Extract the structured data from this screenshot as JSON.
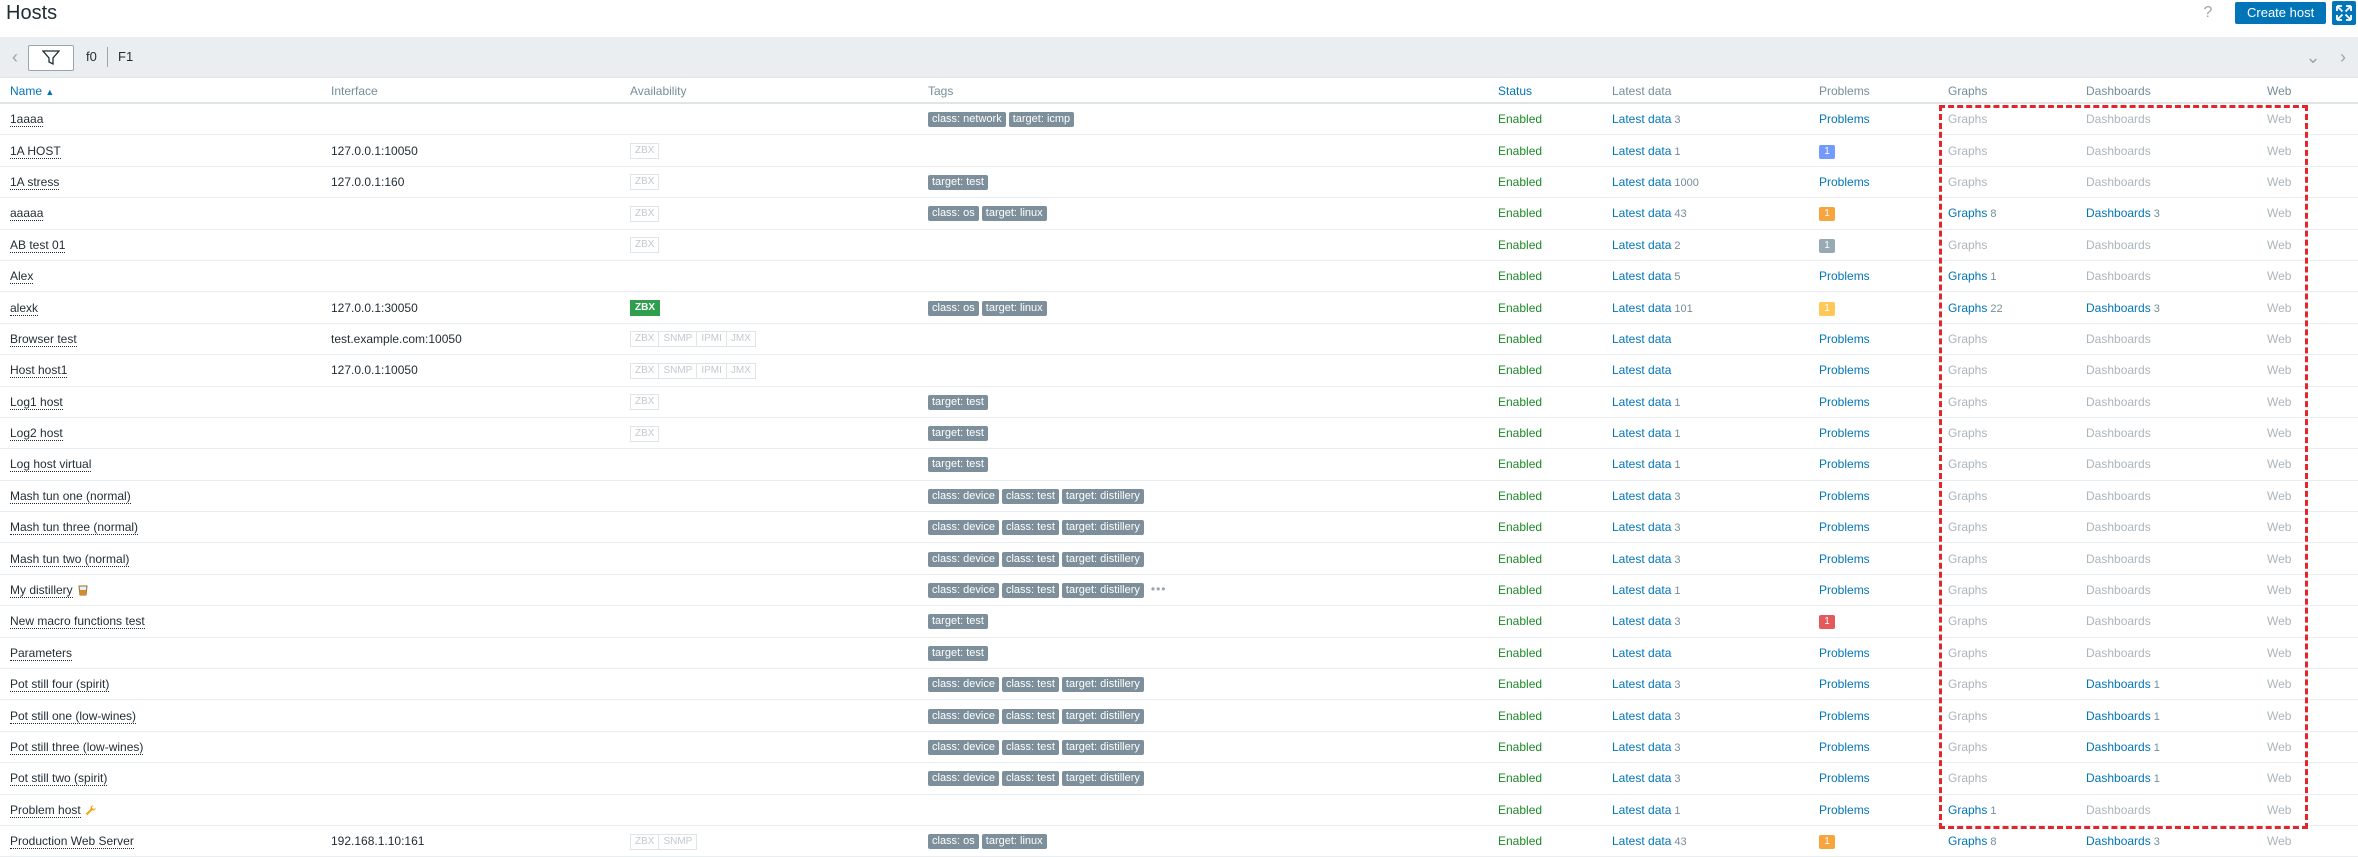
{
  "header": {
    "title": "Hosts",
    "help_label": "?",
    "create_button": "Create host"
  },
  "filter": {
    "tabs": [
      "f0",
      "F1"
    ],
    "prev_icon": "chevron-left-icon",
    "collapse_icon": "chevron-down-icon",
    "next_icon": "chevron-right-icon",
    "filter_icon": "funnel-icon"
  },
  "columns": [
    "Name",
    "Interface",
    "Availability",
    "Tags",
    "Status",
    "Latest data",
    "Problems",
    "Graphs",
    "Dashboards",
    "Web"
  ],
  "sort": {
    "column": "Name",
    "direction": "asc",
    "arrow": "▲"
  },
  "colors": {
    "accent": "#0275b8",
    "enabled": "#1b8a26",
    "highlight": "#e3252c",
    "tag": "#7c8f9a",
    "problem_info": "#7499ff",
    "problem_warning": "#f7a43c",
    "problem_average": "#ffc859",
    "problem_high": "#e45959",
    "problem_notclassified": "#97aab3"
  },
  "rows": [
    {
      "name": "1aaaa",
      "interface": "",
      "avail": [],
      "tags": [
        "class: network",
        "target: icmp"
      ],
      "status": "Enabled",
      "latest": "Latest data",
      "latest_count": "3",
      "problems": "Problems",
      "problem_badge": null,
      "graphs": "Graphs",
      "graphs_count": "",
      "graphs_active": false,
      "dashboards": "Dashboards",
      "dashboards_count": "",
      "dashboards_active": false,
      "web": "Web"
    },
    {
      "name": "1A HOST",
      "interface": "127.0.0.1:10050",
      "avail": [
        {
          "l": "ZBX",
          "on": false
        }
      ],
      "tags": [],
      "status": "Enabled",
      "latest": "Latest data",
      "latest_count": "1",
      "problems": "",
      "problem_badge": {
        "v": "1",
        "c": "#7499ff"
      },
      "graphs": "Graphs",
      "graphs_count": "",
      "graphs_active": false,
      "dashboards": "Dashboards",
      "dashboards_count": "",
      "dashboards_active": false,
      "web": "Web"
    },
    {
      "name": "1A stress",
      "interface": "127.0.0.1:160",
      "avail": [
        {
          "l": "ZBX",
          "on": false
        }
      ],
      "tags": [
        "target: test"
      ],
      "status": "Enabled",
      "latest": "Latest data",
      "latest_count": "1000",
      "problems": "Problems",
      "problem_badge": null,
      "graphs": "Graphs",
      "graphs_count": "",
      "graphs_active": false,
      "dashboards": "Dashboards",
      "dashboards_count": "",
      "dashboards_active": false,
      "web": "Web"
    },
    {
      "name": "aaaaa",
      "interface": "",
      "avail": [
        {
          "l": "ZBX",
          "on": false
        }
      ],
      "tags": [
        "class: os",
        "target: linux"
      ],
      "status": "Enabled",
      "latest": "Latest data",
      "latest_count": "43",
      "problems": "",
      "problem_badge": {
        "v": "1",
        "c": "#f7a43c"
      },
      "graphs": "Graphs",
      "graphs_count": "8",
      "graphs_active": true,
      "dashboards": "Dashboards",
      "dashboards_count": "3",
      "dashboards_active": true,
      "web": "Web"
    },
    {
      "name": "AB test 01",
      "interface": "",
      "avail": [
        {
          "l": "ZBX",
          "on": false
        }
      ],
      "tags": [],
      "status": "Enabled",
      "latest": "Latest data",
      "latest_count": "2",
      "problems": "",
      "problem_badge": {
        "v": "1",
        "c": "#97aab3"
      },
      "graphs": "Graphs",
      "graphs_count": "",
      "graphs_active": false,
      "dashboards": "Dashboards",
      "dashboards_count": "",
      "dashboards_active": false,
      "web": "Web"
    },
    {
      "name": "Alex",
      "interface": "",
      "avail": [],
      "tags": [],
      "status": "Enabled",
      "latest": "Latest data",
      "latest_count": "5",
      "problems": "Problems",
      "problem_badge": null,
      "graphs": "Graphs",
      "graphs_count": "1",
      "graphs_active": true,
      "dashboards": "Dashboards",
      "dashboards_count": "",
      "dashboards_active": false,
      "web": "Web"
    },
    {
      "name": "alexk",
      "interface": "127.0.0.1:30050",
      "avail": [
        {
          "l": "ZBX",
          "on": true
        }
      ],
      "tags": [
        "class: os",
        "target: linux"
      ],
      "status": "Enabled",
      "latest": "Latest data",
      "latest_count": "101",
      "problems": "",
      "problem_badge": {
        "v": "1",
        "c": "#ffc859"
      },
      "graphs": "Graphs",
      "graphs_count": "22",
      "graphs_active": true,
      "dashboards": "Dashboards",
      "dashboards_count": "3",
      "dashboards_active": true,
      "web": "Web"
    },
    {
      "name": "Browser test",
      "interface": "test.example.com:10050",
      "avail": [
        {
          "l": "ZBX",
          "on": false
        },
        {
          "l": "SNMP",
          "on": false
        },
        {
          "l": "IPMI",
          "on": false
        },
        {
          "l": "JMX",
          "on": false
        }
      ],
      "tags": [],
      "status": "Enabled",
      "latest": "Latest data",
      "latest_count": "",
      "problems": "Problems",
      "problem_badge": null,
      "graphs": "Graphs",
      "graphs_count": "",
      "graphs_active": false,
      "dashboards": "Dashboards",
      "dashboards_count": "",
      "dashboards_active": false,
      "web": "Web"
    },
    {
      "name": "Host host1",
      "interface": "127.0.0.1:10050",
      "avail": [
        {
          "l": "ZBX",
          "on": false
        },
        {
          "l": "SNMP",
          "on": false
        },
        {
          "l": "IPMI",
          "on": false
        },
        {
          "l": "JMX",
          "on": false
        }
      ],
      "tags": [],
      "status": "Enabled",
      "latest": "Latest data",
      "latest_count": "",
      "problems": "Problems",
      "problem_badge": null,
      "graphs": "Graphs",
      "graphs_count": "",
      "graphs_active": false,
      "dashboards": "Dashboards",
      "dashboards_count": "",
      "dashboards_active": false,
      "web": "Web"
    },
    {
      "name": "Log1 host",
      "interface": "",
      "avail": [
        {
          "l": "ZBX",
          "on": false
        }
      ],
      "tags": [
        "target: test"
      ],
      "status": "Enabled",
      "latest": "Latest data",
      "latest_count": "1",
      "problems": "Problems",
      "problem_badge": null,
      "graphs": "Graphs",
      "graphs_count": "",
      "graphs_active": false,
      "dashboards": "Dashboards",
      "dashboards_count": "",
      "dashboards_active": false,
      "web": "Web"
    },
    {
      "name": "Log2 host",
      "interface": "",
      "avail": [
        {
          "l": "ZBX",
          "on": false
        }
      ],
      "tags": [
        "target: test"
      ],
      "status": "Enabled",
      "latest": "Latest data",
      "latest_count": "1",
      "problems": "Problems",
      "problem_badge": null,
      "graphs": "Graphs",
      "graphs_count": "",
      "graphs_active": false,
      "dashboards": "Dashboards",
      "dashboards_count": "",
      "dashboards_active": false,
      "web": "Web"
    },
    {
      "name": "Log host virtual",
      "interface": "",
      "avail": [],
      "tags": [
        "target: test"
      ],
      "status": "Enabled",
      "latest": "Latest data",
      "latest_count": "1",
      "problems": "Problems",
      "problem_badge": null,
      "graphs": "Graphs",
      "graphs_count": "",
      "graphs_active": false,
      "dashboards": "Dashboards",
      "dashboards_count": "",
      "dashboards_active": false,
      "web": "Web"
    },
    {
      "name": "Mash tun one (normal)",
      "interface": "",
      "avail": [],
      "tags": [
        "class: device",
        "class: test",
        "target: distillery"
      ],
      "status": "Enabled",
      "latest": "Latest data",
      "latest_count": "3",
      "problems": "Problems",
      "problem_badge": null,
      "graphs": "Graphs",
      "graphs_count": "",
      "graphs_active": false,
      "dashboards": "Dashboards",
      "dashboards_count": "",
      "dashboards_active": false,
      "web": "Web"
    },
    {
      "name": "Mash tun three (normal)",
      "interface": "",
      "avail": [],
      "tags": [
        "class: device",
        "class: test",
        "target: distillery"
      ],
      "status": "Enabled",
      "latest": "Latest data",
      "latest_count": "3",
      "problems": "Problems",
      "problem_badge": null,
      "graphs": "Graphs",
      "graphs_count": "",
      "graphs_active": false,
      "dashboards": "Dashboards",
      "dashboards_count": "",
      "dashboards_active": false,
      "web": "Web"
    },
    {
      "name": "Mash tun two (normal)",
      "interface": "",
      "avail": [],
      "tags": [
        "class: device",
        "class: test",
        "target: distillery"
      ],
      "status": "Enabled",
      "latest": "Latest data",
      "latest_count": "3",
      "problems": "Problems",
      "problem_badge": null,
      "graphs": "Graphs",
      "graphs_count": "",
      "graphs_active": false,
      "dashboards": "Dashboards",
      "dashboards_count": "",
      "dashboards_active": false,
      "web": "Web"
    },
    {
      "name": "My distillery",
      "name_icon": "whisky-glass-icon",
      "interface": "",
      "avail": [],
      "tags": [
        "class: device",
        "class: test",
        "target: distillery"
      ],
      "tags_more": "•••",
      "status": "Enabled",
      "latest": "Latest data",
      "latest_count": "1",
      "problems": "Problems",
      "problem_badge": null,
      "graphs": "Graphs",
      "graphs_count": "",
      "graphs_active": false,
      "dashboards": "Dashboards",
      "dashboards_count": "",
      "dashboards_active": false,
      "web": "Web"
    },
    {
      "name": "New macro functions test",
      "interface": "",
      "avail": [],
      "tags": [
        "target: test"
      ],
      "status": "Enabled",
      "latest": "Latest data",
      "latest_count": "3",
      "problems": "",
      "problem_badge": {
        "v": "1",
        "c": "#e45959"
      },
      "graphs": "Graphs",
      "graphs_count": "",
      "graphs_active": false,
      "dashboards": "Dashboards",
      "dashboards_count": "",
      "dashboards_active": false,
      "web": "Web"
    },
    {
      "name": "Parameters",
      "interface": "",
      "avail": [],
      "tags": [
        "target: test"
      ],
      "status": "Enabled",
      "latest": "Latest data",
      "latest_count": "",
      "problems": "Problems",
      "problem_badge": null,
      "graphs": "Graphs",
      "graphs_count": "",
      "graphs_active": false,
      "dashboards": "Dashboards",
      "dashboards_count": "",
      "dashboards_active": false,
      "web": "Web"
    },
    {
      "name": "Pot still four (spirit)",
      "interface": "",
      "avail": [],
      "tags": [
        "class: device",
        "class: test",
        "target: distillery"
      ],
      "status": "Enabled",
      "latest": "Latest data",
      "latest_count": "3",
      "problems": "Problems",
      "problem_badge": null,
      "graphs": "Graphs",
      "graphs_count": "",
      "graphs_active": false,
      "dashboards": "Dashboards",
      "dashboards_count": "1",
      "dashboards_active": true,
      "web": "Web"
    },
    {
      "name": "Pot still one (low-wines)",
      "interface": "",
      "avail": [],
      "tags": [
        "class: device",
        "class: test",
        "target: distillery"
      ],
      "status": "Enabled",
      "latest": "Latest data",
      "latest_count": "3",
      "problems": "Problems",
      "problem_badge": null,
      "graphs": "Graphs",
      "graphs_count": "",
      "graphs_active": false,
      "dashboards": "Dashboards",
      "dashboards_count": "1",
      "dashboards_active": true,
      "web": "Web"
    },
    {
      "name": "Pot still three (low-wines)",
      "interface": "",
      "avail": [],
      "tags": [
        "class: device",
        "class: test",
        "target: distillery"
      ],
      "status": "Enabled",
      "latest": "Latest data",
      "latest_count": "3",
      "problems": "Problems",
      "problem_badge": null,
      "graphs": "Graphs",
      "graphs_count": "",
      "graphs_active": false,
      "dashboards": "Dashboards",
      "dashboards_count": "1",
      "dashboards_active": true,
      "web": "Web"
    },
    {
      "name": "Pot still two (spirit)",
      "interface": "",
      "avail": [],
      "tags": [
        "class: device",
        "class: test",
        "target: distillery"
      ],
      "status": "Enabled",
      "latest": "Latest data",
      "latest_count": "3",
      "problems": "Problems",
      "problem_badge": null,
      "graphs": "Graphs",
      "graphs_count": "",
      "graphs_active": false,
      "dashboards": "Dashboards",
      "dashboards_count": "1",
      "dashboards_active": true,
      "web": "Web"
    },
    {
      "name": "Problem host",
      "name_icon": "wrench-icon",
      "interface": "",
      "avail": [],
      "tags": [],
      "status": "Enabled",
      "latest": "Latest data",
      "latest_count": "1",
      "problems": "Problems",
      "problem_badge": null,
      "graphs": "Graphs",
      "graphs_count": "1",
      "graphs_active": true,
      "dashboards": "Dashboards",
      "dashboards_count": "",
      "dashboards_active": false,
      "web": "Web"
    },
    {
      "name": "Production Web Server",
      "interface": "192.168.1.10:161",
      "avail": [
        {
          "l": "ZBX",
          "on": false
        },
        {
          "l": "SNMP",
          "on": false
        }
      ],
      "tags": [
        "class: os",
        "target: linux"
      ],
      "status": "Enabled",
      "latest": "Latest data",
      "latest_count": "43",
      "problems": "",
      "problem_badge": {
        "v": "1",
        "c": "#f7a43c"
      },
      "graphs": "Graphs",
      "graphs_count": "8",
      "graphs_active": true,
      "dashboards": "Dashboards",
      "dashboards_count": "3",
      "dashboards_active": true,
      "web": "Web"
    }
  ]
}
